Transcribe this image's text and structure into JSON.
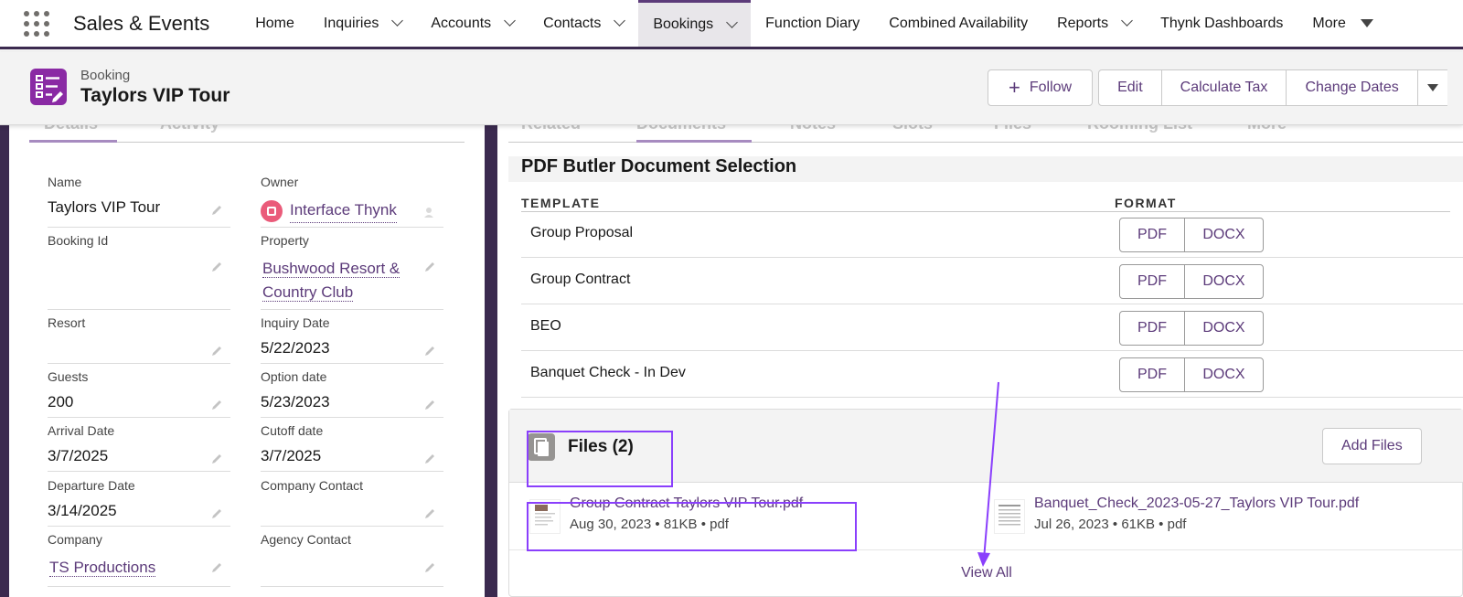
{
  "nav": {
    "app_name": "Sales & Events",
    "items": [
      {
        "label": "Home",
        "dropdown": false
      },
      {
        "label": "Inquiries",
        "dropdown": true
      },
      {
        "label": "Accounts",
        "dropdown": true
      },
      {
        "label": "Contacts",
        "dropdown": true
      },
      {
        "label": "Bookings",
        "dropdown": true,
        "active": true
      },
      {
        "label": "Function Diary",
        "dropdown": false
      },
      {
        "label": "Combined Availability",
        "dropdown": false
      },
      {
        "label": "Reports",
        "dropdown": true
      },
      {
        "label": "Thynk Dashboards",
        "dropdown": false
      },
      {
        "label": "More",
        "dropdown": true
      }
    ]
  },
  "header": {
    "object_label": "Booking",
    "record_name": "Taylors VIP Tour",
    "follow_label": "Follow",
    "actions": [
      "Edit",
      "Calculate Tax",
      "Change Dates"
    ]
  },
  "left_tabs": [
    "Details",
    "Activity"
  ],
  "right_tabs": [
    "Related",
    "Documents",
    "Notes",
    "Slots",
    "Files",
    "Rooming List",
    "More"
  ],
  "fields": {
    "name_label": "Name",
    "name_value": "Taylors VIP Tour",
    "owner_label": "Owner",
    "owner_value": "Interface Thynk",
    "booking_id_label": "Booking Id",
    "booking_id_value": "",
    "property_label": "Property",
    "property_value_1": "Bushwood Resort &",
    "property_value_2": "Country Club",
    "resort_label": "Resort",
    "resort_value": "",
    "inquiry_date_label": "Inquiry Date",
    "inquiry_date_value": "5/22/2023",
    "guests_label": "Guests",
    "guests_value": "200",
    "option_date_label": "Option date",
    "option_date_value": "5/23/2023",
    "arrival_label": "Arrival Date",
    "arrival_value": "3/7/2025",
    "cutoff_label": "Cutoff date",
    "cutoff_value": "3/7/2025",
    "departure_label": "Departure Date",
    "departure_value": "3/14/2025",
    "company_contact_label": "Company Contact",
    "company_contact_value": "",
    "company_label": "Company",
    "company_value": "TS Productions",
    "agency_contact_label": "Agency Contact",
    "agency_contact_value": ""
  },
  "pdf_butler": {
    "title": "PDF Butler Document Selection",
    "col_template": "TEMPLATE",
    "col_format": "FORMAT",
    "templates": [
      "Group Proposal",
      "Group Contract",
      "BEO",
      "Banquet Check - In Dev"
    ],
    "pdf_label": "PDF",
    "docx_label": "DOCX"
  },
  "files": {
    "title": "Files (2)",
    "add_label": "Add Files",
    "items": [
      {
        "name": "Group Contract Taylors VIP Tour.pdf",
        "meta": "Aug 30, 2023  •  81KB  •  pdf"
      },
      {
        "name": "Banquet_Check_2023-05-27_Taylors VIP Tour.pdf",
        "meta": "Jul 26, 2023  •  61KB  •  pdf"
      }
    ],
    "view_all": "View All"
  },
  "colors": {
    "accent": "#5c3b7a",
    "nav_border": "#3b2a4f",
    "record_icon": "#8a2aa4",
    "annotation": "#8a3ffc"
  },
  "icons": {
    "app_launcher": "app-launcher-icon",
    "record": "booking-checklist-icon",
    "files": "files-icon",
    "edit": "pencil-icon",
    "owner": "user-avatar-icon"
  }
}
